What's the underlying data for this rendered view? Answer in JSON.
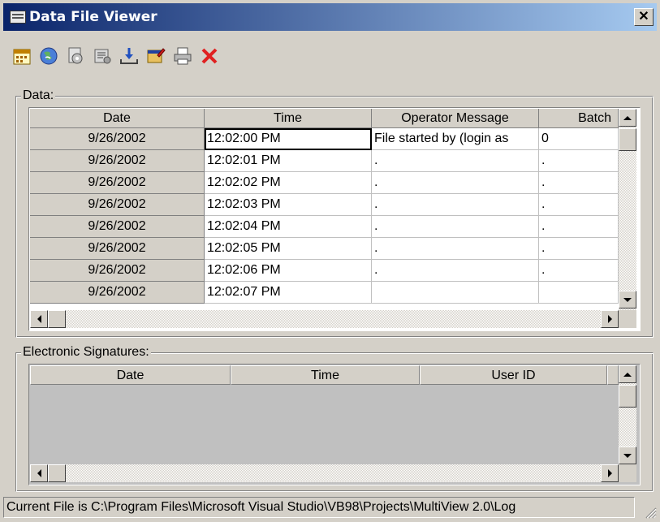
{
  "window": {
    "title": "Data File Viewer",
    "close_glyph": "✕"
  },
  "toolbar": [
    {
      "icon": "calendar-icon"
    },
    {
      "icon": "globe-icon"
    },
    {
      "icon": "gear-doc-icon"
    },
    {
      "icon": "doc-icon"
    },
    {
      "icon": "download-tray-icon"
    },
    {
      "icon": "properties-icon"
    },
    {
      "icon": "printer-icon"
    },
    {
      "icon": "delete-x-icon"
    }
  ],
  "data_group": {
    "label": "Data:",
    "columns": [
      "Date",
      "Time",
      "Operator Message",
      "Batch"
    ],
    "rows": [
      {
        "date": "9/26/2002",
        "time": "12:02:00 PM",
        "message": "File started by (login as",
        "batch": "0"
      },
      {
        "date": "9/26/2002",
        "time": "12:02:01 PM",
        "message": ".",
        "batch": "."
      },
      {
        "date": "9/26/2002",
        "time": "12:02:02 PM",
        "message": ".",
        "batch": "."
      },
      {
        "date": "9/26/2002",
        "time": "12:02:03 PM",
        "message": ".",
        "batch": "."
      },
      {
        "date": "9/26/2002",
        "time": "12:02:04 PM",
        "message": ".",
        "batch": "."
      },
      {
        "date": "9/26/2002",
        "time": "12:02:05 PM",
        "message": ".",
        "batch": "."
      },
      {
        "date": "9/26/2002",
        "time": "12:02:06 PM",
        "message": ".",
        "batch": "."
      },
      {
        "date": "9/26/2002",
        "time": "12:02:07 PM",
        "message": "",
        "batch": ""
      }
    ]
  },
  "signatures_group": {
    "label": "Electronic Signatures:",
    "columns": [
      "Date",
      "Time",
      "User ID"
    ]
  },
  "status": {
    "text": "Current File is C:\\Program Files\\Microsoft Visual Studio\\VB98\\Projects\\MultiView 2.0\\Log"
  }
}
